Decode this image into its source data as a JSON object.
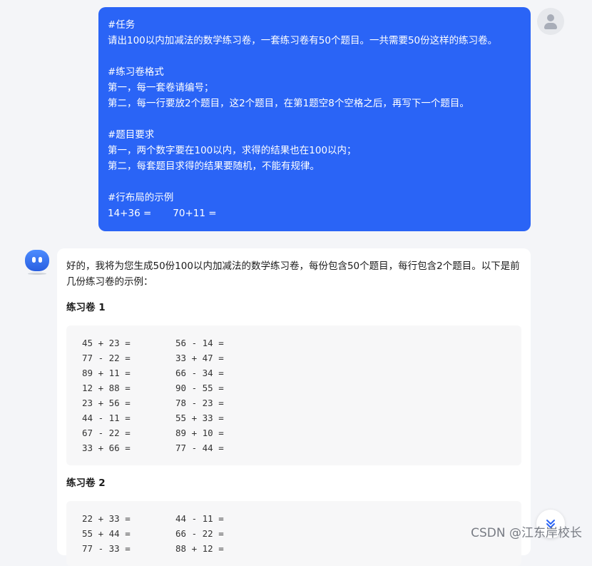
{
  "user_message": {
    "lines": [
      "#任务",
      "请出100以内加减法的数学练习卷，一套练习卷有50个题目。一共需要50份这样的练习卷。",
      "",
      "#练习卷格式",
      "第一，每一套卷请编号；",
      "第二，每一行要放2个题目，这2个题目，在第1题空8个空格之后，再写下一个题目。",
      "",
      "#题目要求",
      "第一，两个数字要在100以内，求得的结果也在100以内；",
      "第二，每套题目求得的结果要随机，不能有规律。",
      "",
      "#行布局的示例",
      "14+36 =       70+11 ="
    ]
  },
  "bot_message": {
    "intro": "好的，我将为您生成50份100以内加减法的数学练习卷，每份包含50个题目，每行包含2个题目。以下是前几份练习卷的示例：",
    "sheets": [
      {
        "title": "练习卷 1",
        "rows": [
          [
            "45 + 23 =",
            "56 - 14 ="
          ],
          [
            "77 - 22 =",
            "33 + 47 ="
          ],
          [
            "89 + 11 =",
            "66 - 34 ="
          ],
          [
            "12 + 88 =",
            "90 - 55 ="
          ],
          [
            "23 + 56 =",
            "78 - 23 ="
          ],
          [
            "44 - 11 =",
            "55 + 33 ="
          ],
          [
            "67 - 22 =",
            "89 + 10 ="
          ],
          [
            "33 + 66 =",
            "77 - 44 ="
          ]
        ]
      },
      {
        "title": "练习卷 2",
        "rows": [
          [
            "22 + 33 =",
            "44 - 11 ="
          ],
          [
            "55 + 44 =",
            "66 - 22 ="
          ],
          [
            "77 - 33 =",
            "88 + 12 ="
          ]
        ]
      }
    ]
  },
  "watermark": "CSDN @江东岸校长",
  "icons": {
    "user_avatar": "user-avatar-icon",
    "bot_avatar": "robot-avatar-icon",
    "scroll_down": "chevron-double-down-icon"
  },
  "colors": {
    "user_bubble": "#2a64f6",
    "background": "#f4f5f8",
    "accent": "#2a64f6"
  }
}
